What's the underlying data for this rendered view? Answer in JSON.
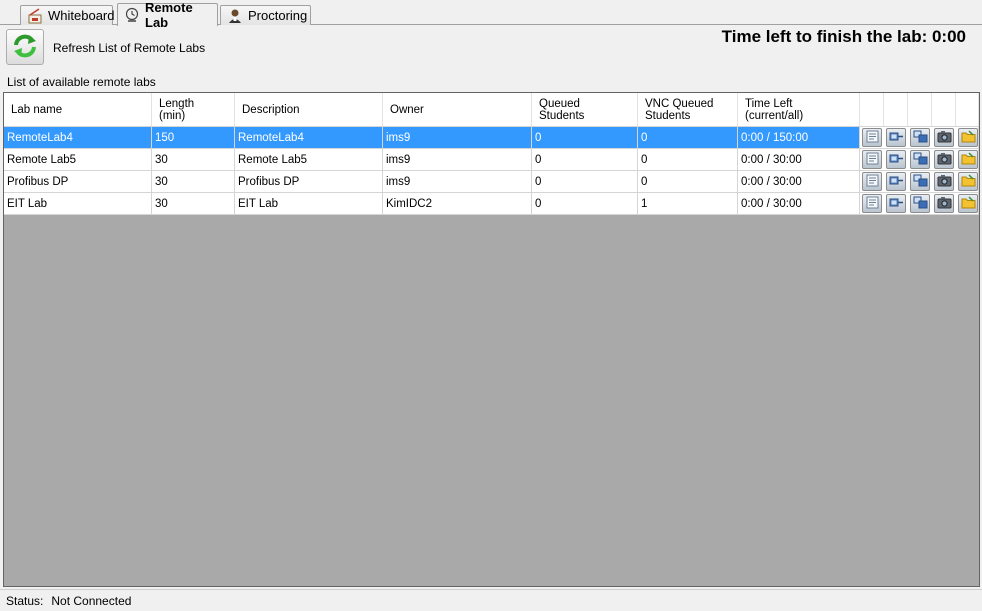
{
  "tabs": [
    {
      "label": "Whiteboard",
      "icon": "whiteboard-icon",
      "active": false
    },
    {
      "label": "Remote Lab",
      "icon": "remote-lab-icon",
      "active": true
    },
    {
      "label": "Proctoring",
      "icon": "proctoring-icon",
      "active": false
    }
  ],
  "toolbar": {
    "refresh_label": "Refresh List of Remote Labs",
    "refresh_icon": "refresh-icon"
  },
  "timer_text": "Time left to finish the lab: 0:00",
  "list_title": "List of available remote labs",
  "table": {
    "columns": [
      {
        "line1": "Lab name",
        "line2": ""
      },
      {
        "line1": "Length",
        "line2": "(min)"
      },
      {
        "line1": "Description",
        "line2": ""
      },
      {
        "line1": "Owner",
        "line2": ""
      },
      {
        "line1": "Queued",
        "line2": "Students"
      },
      {
        "line1": "VNC Queued",
        "line2": "Students"
      },
      {
        "line1": "Time Left",
        "line2": "(current/all)"
      }
    ],
    "rows": [
      {
        "name": "RemoteLab4",
        "length": "150",
        "description": "RemoteLab4",
        "owner": "ims9",
        "queued": "0",
        "vnc_queued": "0",
        "time_left": "0:00 / 150:00",
        "selected": true
      },
      {
        "name": "Remote Lab5",
        "length": "30",
        "description": "Remote Lab5",
        "owner": "ims9",
        "queued": "0",
        "vnc_queued": "0",
        "time_left": "0:00 / 30:00",
        "selected": false
      },
      {
        "name": "Profibus DP",
        "length": "30",
        "description": "Profibus DP",
        "owner": "ims9",
        "queued": "0",
        "vnc_queued": "0",
        "time_left": "0:00 / 30:00",
        "selected": false
      },
      {
        "name": "EIT Lab",
        "length": "30",
        "description": "EIT Lab",
        "owner": "KimIDC2",
        "queued": "0",
        "vnc_queued": "1",
        "time_left": "0:00 / 30:00",
        "selected": false
      }
    ],
    "row_actions": [
      "document-icon",
      "connect-icon",
      "vnc-connect-icon",
      "camera-icon",
      "folder-icon"
    ],
    "selection_color": "#3399ff",
    "empty_area_color": "#a9a9a9"
  },
  "status": {
    "label": "Status:",
    "value": "Not Connected"
  }
}
